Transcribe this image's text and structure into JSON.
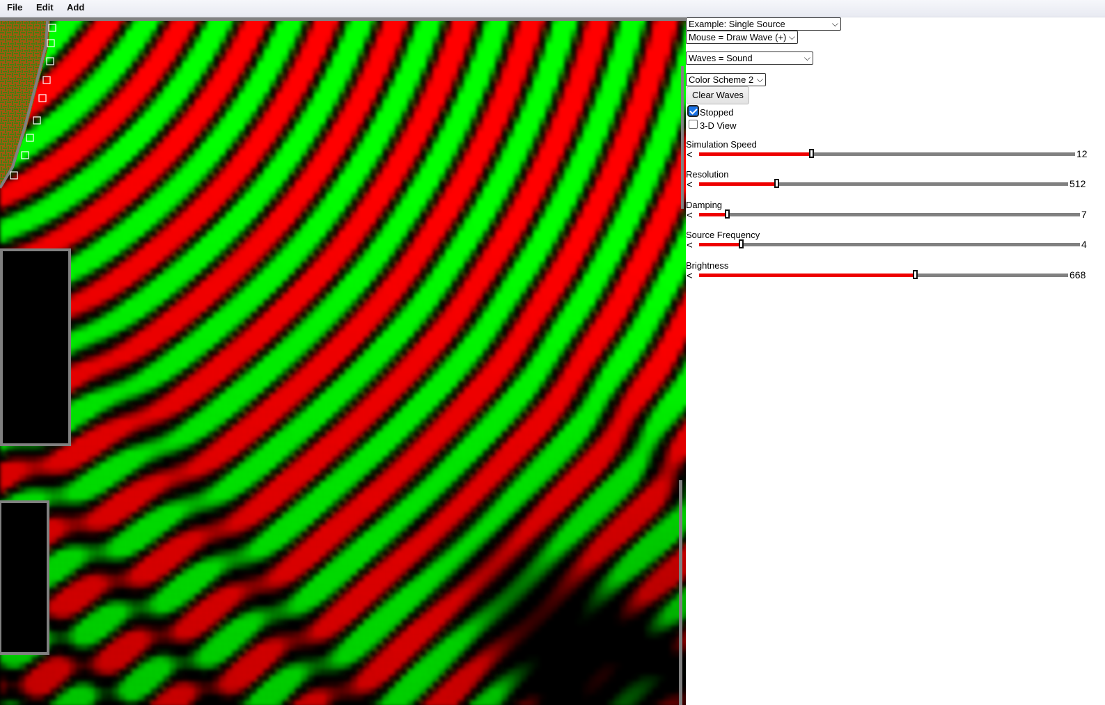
{
  "menu": {
    "file": "File",
    "edit": "Edit",
    "add": "Add"
  },
  "controls": {
    "example_select": "Example: Single Source",
    "mouse_select": "Mouse = Draw Wave (+)",
    "waves_select": "Waves = Sound",
    "color_select": "Color Scheme 2",
    "clear_button": "Clear Waves",
    "stopped_label": "Stopped",
    "stopped_checked": true,
    "view3d_label": "3-D View",
    "view3d_checked": false
  },
  "sliders": [
    {
      "label": "Simulation Speed",
      "value": "12",
      "fraction": 0.298
    },
    {
      "label": "Resolution",
      "value": "512",
      "fraction": 0.21
    },
    {
      "label": "Damping",
      "value": "7",
      "fraction": 0.073
    },
    {
      "label": "Source Frequency",
      "value": "4",
      "fraction": 0.109
    },
    {
      "label": "Brightness",
      "value": "668",
      "fraction": 0.585
    }
  ],
  "colors": {
    "positive": "#ff0000",
    "negative": "#00ff00",
    "wall": "#808080",
    "background": "#000000",
    "slider_fill": "#ee0000",
    "slider_track": "#808080"
  }
}
